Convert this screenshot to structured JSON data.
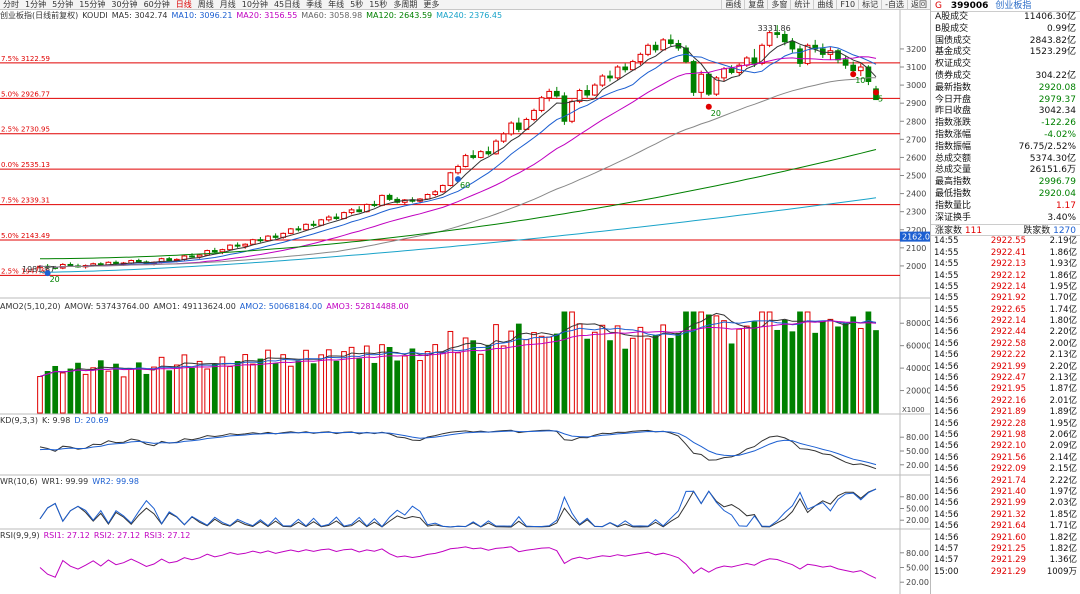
{
  "toolbar": {
    "left": [
      "分时",
      "1分钟",
      "5分钟",
      "15分钟",
      "30分钟",
      "60分钟",
      "日线",
      "周线",
      "月线",
      "10分钟",
      "45日线",
      "季线",
      "年线",
      "5秒",
      "15秒",
      "多周期",
      "更多"
    ],
    "active": "日线",
    "right": [
      "画线",
      "复盘",
      "多窗",
      "统计",
      "曲线",
      "F10",
      "标记",
      "-自选",
      "返回"
    ]
  },
  "main_legend": [
    {
      "text": "创业板指(日线前复权)",
      "color": "#333"
    },
    {
      "text": "KOUDI",
      "color": "#333"
    },
    {
      "text": "MA5: 3042.74",
      "color": "#333"
    },
    {
      "text": "MA10: 3096.21",
      "color": "#1c5fd1"
    },
    {
      "text": "MA20: 3156.55",
      "color": "#c000c0"
    },
    {
      "text": "MA60: 3058.98",
      "color": "#666"
    },
    {
      "text": "MA120: 2643.59",
      "color": "#008000"
    },
    {
      "text": "MA240: 2376.45",
      "color": "#19a3c9"
    }
  ],
  "vol_legend": [
    {
      "text": "AMO2(5,10,20)",
      "color": "#333"
    },
    {
      "text": "AMOW: 53743764.00",
      "color": "#333"
    },
    {
      "text": "AMO1: 49113624.00",
      "color": "#333"
    },
    {
      "text": "AMO2: 50068184.00",
      "color": "#1c5fd1"
    },
    {
      "text": "AMO3: 52814488.00",
      "color": "#c000c0"
    }
  ],
  "kd_legend": [
    {
      "text": "KD(9,3,3)",
      "color": "#333"
    },
    {
      "text": "K: 9.98",
      "color": "#333"
    },
    {
      "text": "D: 20.69",
      "color": "#1c5fd1"
    }
  ],
  "wr_legend": [
    {
      "text": "WR(10,6)",
      "color": "#333"
    },
    {
      "text": "WR1: 99.99",
      "color": "#333"
    },
    {
      "text": "WR2: 99.98",
      "color": "#1c5fd1"
    }
  ],
  "rsi_legend": [
    {
      "text": "RSI(9,9,9)",
      "color": "#333"
    },
    {
      "text": "RSI1: 27.12",
      "color": "#c000c0"
    },
    {
      "text": "RSI2: 27.12",
      "color": "#c000c0"
    },
    {
      "text": "RSI3: 27.12",
      "color": "#c000c0"
    }
  ],
  "price_axis": {
    "min": 1900,
    "max": 3360,
    "ticks": [
      2000,
      2100,
      2200,
      2300,
      2400,
      2500,
      2600,
      2700,
      2800,
      2900,
      3000,
      3100,
      3200
    ]
  },
  "fib_lines": [
    {
      "label": "7.5% 3122.59",
      "value": 3122.59
    },
    {
      "label": "5.0% 2926.77",
      "value": 2926.77
    },
    {
      "label": "2.5% 2730.95",
      "value": 2730.95
    },
    {
      "label": "0.0% 2535.13",
      "value": 2535.13
    },
    {
      "label": "7.5% 2339.31",
      "value": 2339.31
    },
    {
      "label": "5.0% 2143.49",
      "value": 2143.49
    },
    {
      "label": "2.5% 1947.66",
      "value": 1947.66
    }
  ],
  "high_label": "3331.86",
  "low_label": "1981.67",
  "last_price_tag": "2162.0",
  "price_markers": [
    "20",
    "60",
    "20",
    "10",
    "5"
  ],
  "vol_axis": {
    "ticks": [
      "80000",
      "60000",
      "40000",
      "20000"
    ],
    "unit": "X1000"
  },
  "osc_axis": {
    "ticks": [
      "80.00",
      "50.00",
      "20.00"
    ]
  },
  "chart_data": {
    "type": "candlestick",
    "title": "创业板指(日线前复权)",
    "ma_values": {
      "MA5": 3042.74,
      "MA10": 3096.21,
      "MA20": 3156.55,
      "MA60": 3058.98,
      "MA120": 2643.59,
      "MA240": 2376.45
    },
    "ohlc": [
      [
        1990,
        2005,
        1975,
        1998
      ],
      [
        1998,
        2010,
        1985,
        1992
      ],
      [
        1992,
        2000,
        1980,
        1988
      ],
      [
        1988,
        2015,
        1982,
        2008
      ],
      [
        2008,
        2020,
        1995,
        2000
      ],
      [
        2000,
        2012,
        1990,
        1995
      ],
      [
        1995,
        2008,
        1985,
        2002
      ],
      [
        2002,
        2018,
        1996,
        2012
      ],
      [
        2012,
        2020,
        1998,
        2003
      ],
      [
        2003,
        2025,
        2000,
        2020
      ],
      [
        2020,
        2030,
        2005,
        2010
      ],
      [
        2010,
        2022,
        2000,
        2016
      ],
      [
        2016,
        2035,
        2010,
        2030
      ],
      [
        2030,
        2040,
        2018,
        2022
      ],
      [
        2022,
        2030,
        2008,
        2012
      ],
      [
        2012,
        2025,
        2002,
        2020
      ],
      [
        2020,
        2045,
        2015,
        2040
      ],
      [
        2040,
        2050,
        2025,
        2030
      ],
      [
        2030,
        2042,
        2020,
        2036
      ],
      [
        2036,
        2060,
        2030,
        2055
      ],
      [
        2055,
        2070,
        2045,
        2050
      ],
      [
        2050,
        2065,
        2040,
        2060
      ],
      [
        2060,
        2090,
        2055,
        2085
      ],
      [
        2085,
        2100,
        2070,
        2078
      ],
      [
        2078,
        2095,
        2065,
        2090
      ],
      [
        2090,
        2120,
        2085,
        2115
      ],
      [
        2115,
        2130,
        2100,
        2110
      ],
      [
        2110,
        2125,
        2095,
        2120
      ],
      [
        2120,
        2150,
        2115,
        2145
      ],
      [
        2145,
        2160,
        2130,
        2140
      ],
      [
        2140,
        2170,
        2135,
        2165
      ],
      [
        2165,
        2180,
        2150,
        2158
      ],
      [
        2158,
        2185,
        2150,
        2180
      ],
      [
        2180,
        2210,
        2175,
        2205
      ],
      [
        2205,
        2220,
        2190,
        2200
      ],
      [
        2200,
        2235,
        2195,
        2230
      ],
      [
        2230,
        2250,
        2215,
        2225
      ],
      [
        2225,
        2260,
        2220,
        2255
      ],
      [
        2255,
        2280,
        2245,
        2270
      ],
      [
        2270,
        2290,
        2255,
        2262
      ],
      [
        2262,
        2300,
        2258,
        2295
      ],
      [
        2295,
        2320,
        2285,
        2310
      ],
      [
        2310,
        2330,
        2295,
        2300
      ],
      [
        2300,
        2345,
        2295,
        2340
      ],
      [
        2340,
        2360,
        2325,
        2335
      ],
      [
        2335,
        2395,
        2330,
        2390
      ],
      [
        2390,
        2400,
        2360,
        2368
      ],
      [
        2368,
        2380,
        2345,
        2352
      ],
      [
        2352,
        2370,
        2340,
        2365
      ],
      [
        2365,
        2380,
        2350,
        2358
      ],
      [
        2358,
        2375,
        2345,
        2370
      ],
      [
        2370,
        2400,
        2365,
        2395
      ],
      [
        2395,
        2420,
        2385,
        2410
      ],
      [
        2410,
        2450,
        2405,
        2445
      ],
      [
        2445,
        2520,
        2440,
        2515
      ],
      [
        2515,
        2560,
        2505,
        2550
      ],
      [
        2550,
        2620,
        2545,
        2610
      ],
      [
        2610,
        2640,
        2590,
        2600
      ],
      [
        2600,
        2640,
        2595,
        2632
      ],
      [
        2632,
        2660,
        2610,
        2620
      ],
      [
        2620,
        2700,
        2615,
        2690
      ],
      [
        2690,
        2740,
        2680,
        2730
      ],
      [
        2730,
        2800,
        2720,
        2790
      ],
      [
        2790,
        2820,
        2740,
        2755
      ],
      [
        2755,
        2820,
        2750,
        2810
      ],
      [
        2810,
        2870,
        2800,
        2860
      ],
      [
        2860,
        2940,
        2850,
        2930
      ],
      [
        2930,
        2980,
        2910,
        2965
      ],
      [
        2965,
        2990,
        2930,
        2940
      ],
      [
        2940,
        2960,
        2780,
        2800
      ],
      [
        2800,
        2920,
        2790,
        2910
      ],
      [
        2910,
        2980,
        2900,
        2970
      ],
      [
        2970,
        3000,
        2930,
        2945
      ],
      [
        2945,
        3010,
        2940,
        3000
      ],
      [
        3000,
        3060,
        2990,
        3050
      ],
      [
        3050,
        3080,
        3020,
        3040
      ],
      [
        3040,
        3110,
        3030,
        3100
      ],
      [
        3100,
        3120,
        3070,
        3085
      ],
      [
        3085,
        3140,
        3080,
        3130
      ],
      [
        3130,
        3180,
        3110,
        3170
      ],
      [
        3170,
        3230,
        3160,
        3220
      ],
      [
        3220,
        3240,
        3180,
        3195
      ],
      [
        3195,
        3260,
        3190,
        3250
      ],
      [
        3250,
        3280,
        3215,
        3230
      ],
      [
        3230,
        3250,
        3190,
        3205
      ],
      [
        3205,
        3220,
        3120,
        3130
      ],
      [
        3130,
        3140,
        2940,
        2960
      ],
      [
        2960,
        3080,
        2930,
        3060
      ],
      [
        3060,
        3070,
        2940,
        2950
      ],
      [
        2950,
        3050,
        2940,
        3040
      ],
      [
        3040,
        3100,
        3020,
        3090
      ],
      [
        3090,
        3110,
        3060,
        3070
      ],
      [
        3070,
        3120,
        3050,
        3110
      ],
      [
        3110,
        3160,
        3100,
        3150
      ],
      [
        3150,
        3200,
        3100,
        3120
      ],
      [
        3120,
        3230,
        3110,
        3220
      ],
      [
        3220,
        3300,
        3210,
        3290
      ],
      [
        3290,
        3332,
        3260,
        3280
      ],
      [
        3280,
        3300,
        3220,
        3240
      ],
      [
        3240,
        3260,
        3180,
        3200
      ],
      [
        3200,
        3220,
        3100,
        3120
      ],
      [
        3120,
        3230,
        3110,
        3220
      ],
      [
        3220,
        3250,
        3180,
        3200
      ],
      [
        3200,
        3230,
        3150,
        3170
      ],
      [
        3170,
        3210,
        3140,
        3190
      ],
      [
        3190,
        3200,
        3120,
        3140
      ],
      [
        3140,
        3160,
        3090,
        3110
      ],
      [
        3110,
        3130,
        3060,
        3080
      ],
      [
        3080,
        3120,
        3050,
        3100
      ],
      [
        3100,
        3110,
        3000,
        3020
      ],
      [
        2979,
        2996,
        2920,
        2920
      ]
    ]
  },
  "sidebar": {
    "g": "G",
    "code": "399006",
    "name": "创业板指",
    "rows": [
      {
        "label": "A股成交",
        "value": "11406.30亿",
        "cls": ""
      },
      {
        "label": "B股成交",
        "value": "0.99亿",
        "cls": ""
      },
      {
        "label": "国债成交",
        "value": "2843.82亿",
        "cls": ""
      },
      {
        "label": "基金成交",
        "value": "1523.29亿",
        "cls": ""
      },
      {
        "label": "权证成交",
        "value": "",
        "cls": ""
      },
      {
        "label": "债券成交",
        "value": "304.22亿",
        "cls": ""
      },
      {
        "label": "最新指数",
        "value": "2920.08",
        "cls": "grn"
      },
      {
        "label": "今日开盘",
        "value": "2979.37",
        "cls": "grn"
      },
      {
        "label": "昨日收盘",
        "value": "3042.34",
        "cls": ""
      },
      {
        "label": "指数涨跌",
        "value": "-122.26",
        "cls": "grn"
      },
      {
        "label": "指数涨幅",
        "value": "-4.02%",
        "cls": "grn"
      },
      {
        "label": "指数振幅",
        "value": "76.75/2.52%",
        "cls": ""
      },
      {
        "label": "总成交额",
        "value": "5374.30亿",
        "cls": ""
      },
      {
        "label": "总成交量",
        "value": "26151.6万",
        "cls": ""
      },
      {
        "label": "最高指数",
        "value": "2996.79",
        "cls": "grn"
      },
      {
        "label": "最低指数",
        "value": "2920.04",
        "cls": "grn"
      },
      {
        "label": "指数量比",
        "value": "1.17",
        "cls": "red"
      },
      {
        "label": "深证换手",
        "value": "3.40%",
        "cls": ""
      }
    ],
    "up_label": "涨家数",
    "up_count": "111",
    "down_label": "跌家数",
    "down_count": "1270",
    "ticks": [
      [
        "14:55",
        "2922.55",
        "2.19亿"
      ],
      [
        "14:55",
        "2922.41",
        "1.86亿"
      ],
      [
        "14:55",
        "2922.13",
        "1.93亿"
      ],
      [
        "14:55",
        "2922.12",
        "1.86亿"
      ],
      [
        "14:55",
        "2922.14",
        "1.95亿"
      ],
      [
        "14:55",
        "2921.92",
        "1.70亿"
      ],
      [
        "14:55",
        "2922.65",
        "1.74亿"
      ],
      [
        "14:56",
        "2922.14",
        "1.80亿"
      ],
      [
        "14:56",
        "2922.44",
        "2.20亿"
      ],
      [
        "14:56",
        "2922.58",
        "2.00亿"
      ],
      [
        "14:56",
        "2922.22",
        "2.13亿"
      ],
      [
        "14:56",
        "2921.99",
        "2.20亿"
      ],
      [
        "14:56",
        "2922.47",
        "2.13亿"
      ],
      [
        "14:56",
        "2921.95",
        "1.87亿"
      ],
      [
        "14:56",
        "2922.16",
        "2.01亿"
      ],
      [
        "14:56",
        "2921.89",
        "1.89亿"
      ],
      [
        "14:56",
        "2922.28",
        "1.95亿"
      ],
      [
        "14:56",
        "2921.98",
        "2.06亿"
      ],
      [
        "14:56",
        "2922.10",
        "2.09亿"
      ],
      [
        "14:56",
        "2921.56",
        "2.14亿"
      ],
      [
        "14:56",
        "2922.09",
        "2.15亿"
      ],
      [
        "14:56",
        "2921.74",
        "2.22亿"
      ],
      [
        "14:56",
        "2921.40",
        "1.97亿"
      ],
      [
        "14:56",
        "2921.99",
        "2.03亿"
      ],
      [
        "14:56",
        "2921.32",
        "1.85亿"
      ],
      [
        "14:56",
        "2921.64",
        "1.71亿"
      ],
      [
        "14:56",
        "2921.60",
        "1.82亿"
      ],
      [
        "14:57",
        "2921.25",
        "1.82亿"
      ],
      [
        "14:57",
        "2921.29",
        "1.36亿"
      ],
      [
        "15:00",
        "2921.29",
        "1009万"
      ]
    ]
  }
}
